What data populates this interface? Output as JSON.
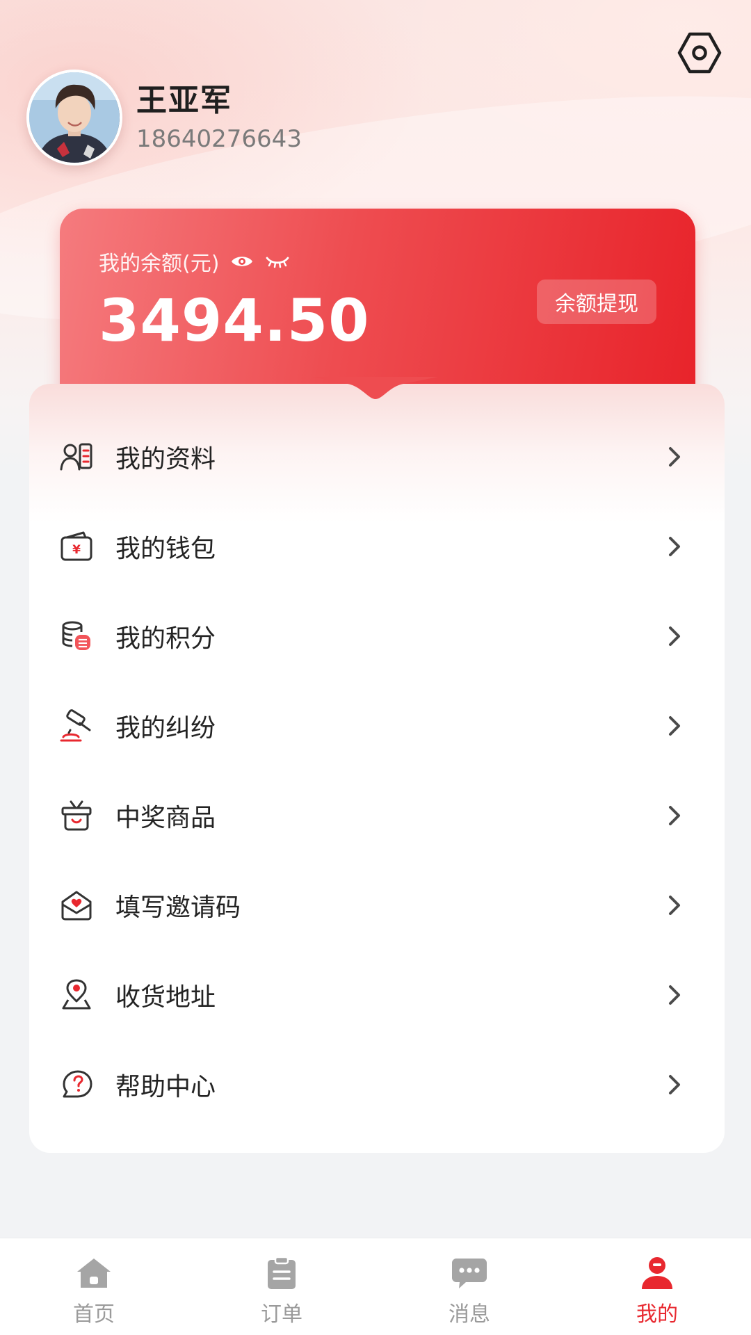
{
  "colors": {
    "accent": "#e8282f",
    "card_gradient_start": "#f57b7e",
    "card_gradient_end": "#e8232a",
    "icon_dark": "#333333",
    "tab_inactive": "#9a9a9a"
  },
  "header": {
    "settings_icon": "settings-hexagon-icon"
  },
  "profile": {
    "name": "王亚军",
    "phone": "18640276643"
  },
  "balance": {
    "label": "我的余额(元)",
    "amount": "3494.50",
    "withdraw_label": "余额提现",
    "show_icon": "eye-icon",
    "hide_icon": "eye-closed-icon"
  },
  "menu": {
    "items": [
      {
        "label": "我的资料",
        "icon": "profile-card-icon"
      },
      {
        "label": "我的钱包",
        "icon": "wallet-icon"
      },
      {
        "label": "我的积分",
        "icon": "coins-stack-icon"
      },
      {
        "label": "我的纠纷",
        "icon": "gavel-icon"
      },
      {
        "label": "中奖商品",
        "icon": "prize-box-icon"
      },
      {
        "label": "填写邀请码",
        "icon": "invite-envelope-icon"
      },
      {
        "label": "收货地址",
        "icon": "location-pin-icon"
      },
      {
        "label": "帮助中心",
        "icon": "help-bubble-icon"
      }
    ]
  },
  "tabbar": {
    "tabs": [
      {
        "label": "首页",
        "icon": "home-icon",
        "active": false
      },
      {
        "label": "订单",
        "icon": "clipboard-icon",
        "active": false
      },
      {
        "label": "消息",
        "icon": "chat-icon",
        "active": false
      },
      {
        "label": "我的",
        "icon": "user-icon",
        "active": true
      }
    ]
  }
}
